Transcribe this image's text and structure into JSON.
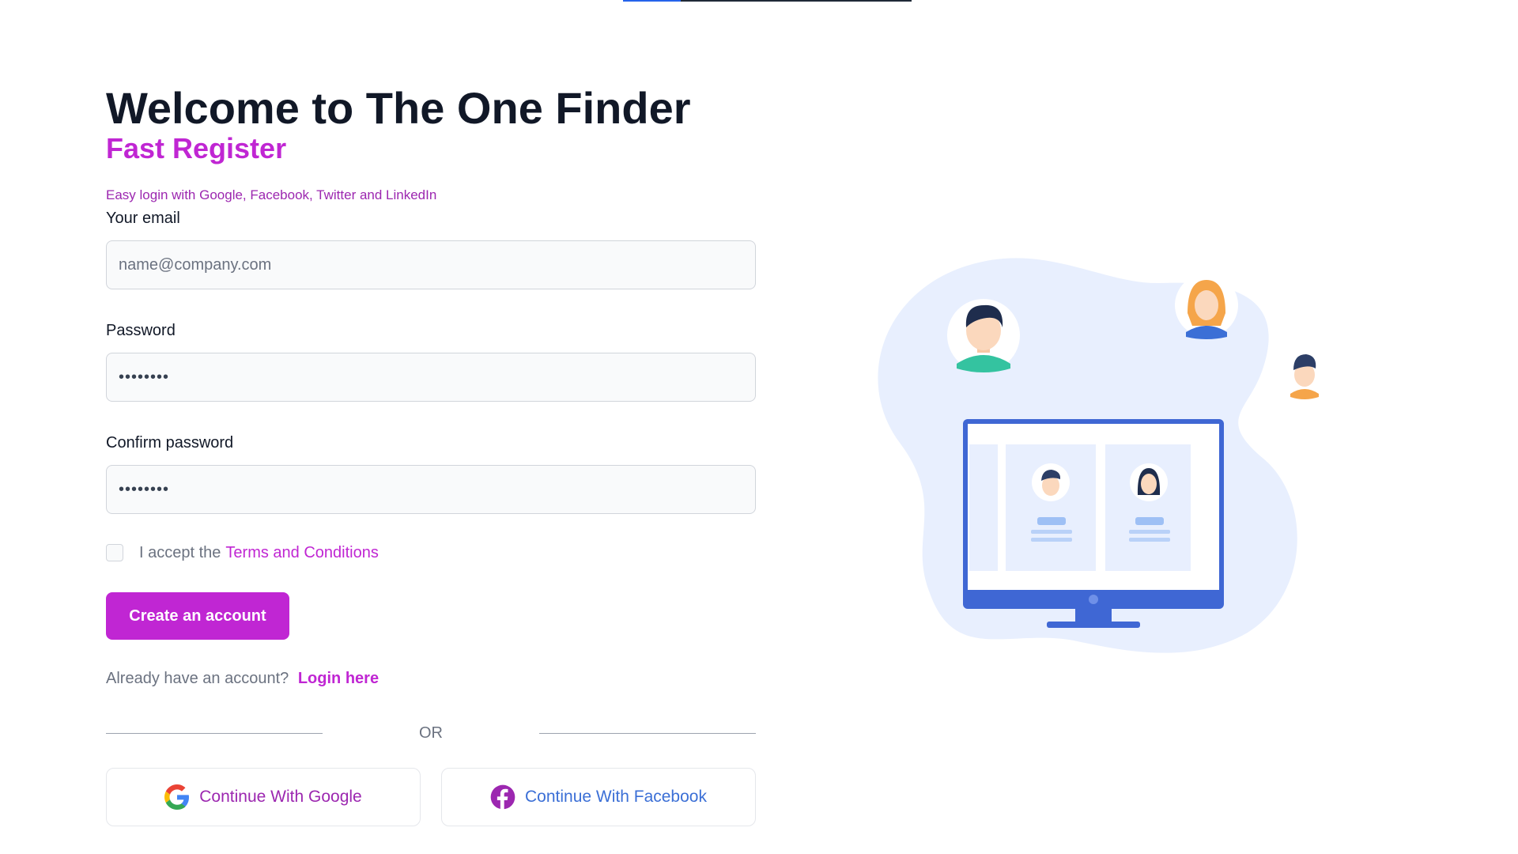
{
  "page": {
    "title": "Welcome to The One Finder",
    "subtitle": "Fast Register",
    "tagline": "Easy login with Google, Facebook, Twitter and LinkedIn"
  },
  "top_progress": {
    "fraction": 0.2
  },
  "form": {
    "email": {
      "label": "Your email",
      "placeholder": "name@company.com",
      "value": ""
    },
    "password": {
      "label": "Password",
      "value": "••••••••"
    },
    "confirm_password": {
      "label": "Confirm password",
      "value": "••••••••"
    },
    "terms": {
      "prefix": "I accept the",
      "link": "Terms and Conditions",
      "checked": false
    },
    "submit_label": "Create an account",
    "login": {
      "prompt": "Already have an account?",
      "link": "Login here"
    },
    "divider": "OR"
  },
  "social": {
    "google": {
      "label": "Continue With Google",
      "icon": "google-icon"
    },
    "facebook": {
      "label": "Continue With Facebook",
      "icon": "facebook-icon"
    }
  },
  "illustration": {
    "icon": "people-monitor-illustration"
  },
  "colors": {
    "accent": "#c026d3",
    "title": "#111827",
    "facebook": "#3b6fd6",
    "blob": "#e8effe",
    "monitor": "#3f67d4"
  }
}
